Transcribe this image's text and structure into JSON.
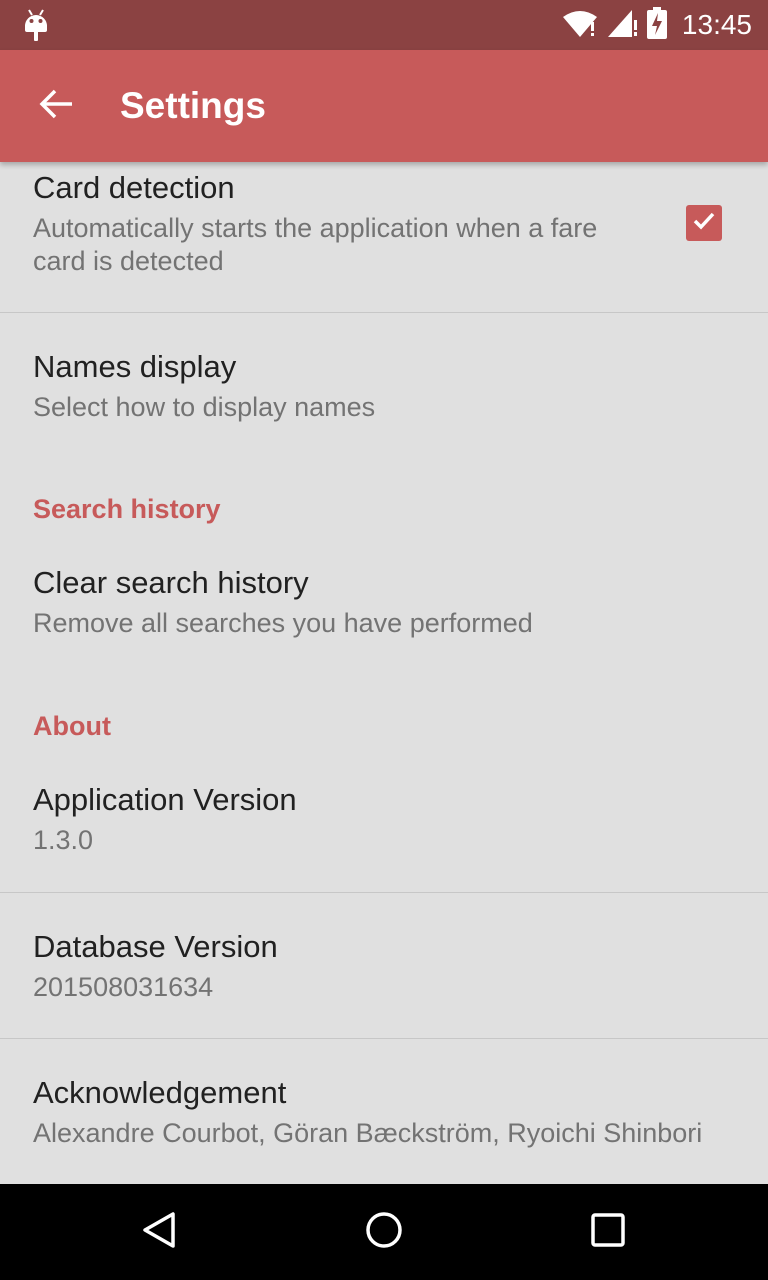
{
  "status_bar": {
    "time": "13:45",
    "icons": [
      "android-debug-icon",
      "wifi-alert-icon",
      "signal-alert-icon",
      "battery-charging-icon"
    ]
  },
  "toolbar": {
    "title": "Settings",
    "back_icon": "arrow-back-icon"
  },
  "colors": {
    "status_bar": "#8b4242",
    "toolbar": "#c75a5a",
    "accent": "#c75a5a",
    "background": "#e0e0e0"
  },
  "preferences": {
    "card_detection": {
      "title": "Card detection",
      "summary": "Automatically starts the application when a fare card is detected",
      "checked": true
    },
    "names_display": {
      "title": "Names display",
      "summary": "Select how to display names"
    },
    "search_history_category": "Search history",
    "clear_search_history": {
      "title": "Clear search history",
      "summary": "Remove all searches you have performed"
    },
    "about_category": "About",
    "app_version": {
      "title": "Application Version",
      "summary": "1.3.0"
    },
    "db_version": {
      "title": "Database Version",
      "summary": "201508031634"
    },
    "acknowledgement": {
      "title": "Acknowledgement",
      "summary": "Alexandre Courbot, Göran Bæckström, Ryoichi Shinbori"
    }
  },
  "nav_bar": {
    "buttons": [
      "back-triangle-icon",
      "home-circle-icon",
      "recents-square-icon"
    ]
  }
}
